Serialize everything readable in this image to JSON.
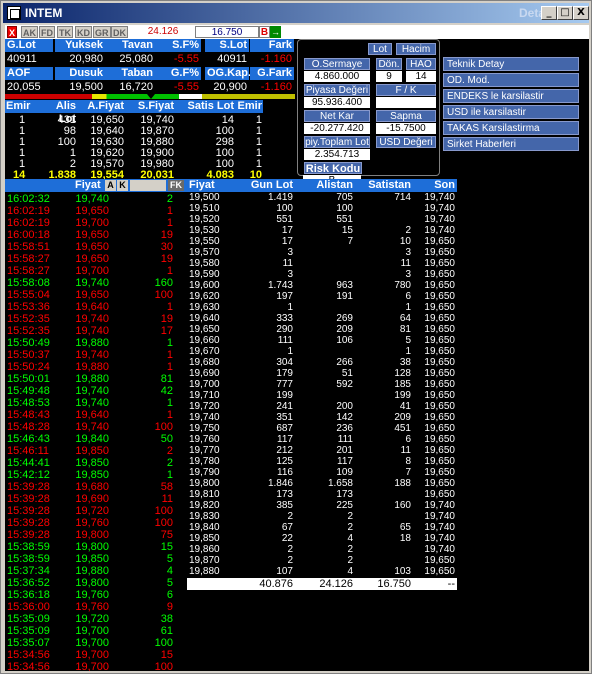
{
  "window": {
    "title": "INTEM",
    "title_right": "Detay",
    "min": "_",
    "max": "□",
    "close": "X"
  },
  "toolbar": {
    "buttons": [
      "X",
      "AK",
      "FD",
      "TK",
      "KD",
      "GR",
      "DK"
    ],
    "price1": "24.126",
    "price2": "16.750",
    "b_label": "B",
    "arrow": "→"
  },
  "summary": {
    "headers1": [
      "G.Lot",
      "Yuksek",
      "Tavan",
      "S.F%",
      "S.Lot",
      "Fark"
    ],
    "row1": [
      "40911",
      "20,980",
      "25,080",
      "-5.55",
      "40911",
      "-1.160"
    ],
    "headers2": [
      "AOF",
      "Dusuk",
      "Taban",
      "G.F%",
      "OG.Kap.",
      "G.Fark"
    ],
    "row2": [
      "20,055",
      "19,500",
      "16,720",
      "-5.55",
      "20,900",
      "-1.160"
    ]
  },
  "mid_panel": {
    "lot": "Lot",
    "hacim": "Hacim",
    "o_sermaye_label": "O.Sermaye",
    "o_sermaye": "4.860.000",
    "don_label": "Dön.",
    "don": "9",
    "hao_label": "HAO",
    "hao": "14",
    "piyasa_label": "Piyasa Değeri",
    "piyasa": "95.936.400",
    "fk_label": "F / K",
    "fk": "",
    "netkar_label": "Net Kar",
    "netkar": "-20.277.420",
    "sapma_label": "Sapma",
    "sapma": "-15.7500",
    "piyl_label": "piy.Toplam Lot",
    "piyl": "2.354.713",
    "usd_label": "USD Değeri",
    "risk_label": "Risk Kodu",
    "risk": "B"
  },
  "right_links": [
    "Teknik Detay",
    "OD. Mod.",
    "ENDEKS le karsilastir",
    "USD ile karsilastir",
    "TAKAS Karsilastirma",
    "Sirket Haberleri"
  ],
  "orderbook": {
    "headers": [
      "Emir",
      "Alis Lot",
      "A.Fiyat",
      "S.Fiyat",
      "Satis Lot",
      "Emir"
    ],
    "rows": [
      [
        "1",
        "431",
        "19,650",
        "19,740",
        "14",
        "1"
      ],
      [
        "1",
        "98",
        "19,640",
        "19,870",
        "100",
        "1"
      ],
      [
        "1",
        "100",
        "19,630",
        "19,880",
        "298",
        "1"
      ],
      [
        "1",
        "1",
        "19,620",
        "19,900",
        "100",
        "1"
      ],
      [
        "1",
        "2",
        "19,570",
        "19,980",
        "100",
        "1"
      ]
    ],
    "total": [
      "14",
      "1.838",
      "19,554",
      "20,031",
      "4.083",
      "10"
    ]
  },
  "ts_header": {
    "fiyat": "Fiyat",
    "a": "A",
    "k": "K",
    "fk": "FK"
  },
  "time_sales": [
    [
      "16:02:32",
      "19,740",
      "2",
      "g"
    ],
    [
      "16:02:19",
      "19,650",
      "1",
      "r"
    ],
    [
      "16:02:19",
      "19,700",
      "1",
      "r"
    ],
    [
      "16:00:18",
      "19,650",
      "19",
      "r"
    ],
    [
      "15:58:51",
      "19,650",
      "30",
      "r"
    ],
    [
      "15:58:27",
      "19,650",
      "19",
      "r"
    ],
    [
      "15:58:27",
      "19,700",
      "1",
      "r"
    ],
    [
      "15:58:08",
      "19,740",
      "160",
      "g"
    ],
    [
      "15:55:04",
      "19,650",
      "100",
      "r"
    ],
    [
      "15:53:36",
      "19,640",
      "1",
      "r"
    ],
    [
      "15:52:35",
      "19,740",
      "19",
      "r"
    ],
    [
      "15:52:35",
      "19,740",
      "17",
      "r"
    ],
    [
      "15:50:49",
      "19,880",
      "1",
      "g"
    ],
    [
      "15:50:37",
      "19,740",
      "1",
      "r"
    ],
    [
      "15:50:24",
      "19,880",
      "1",
      "r"
    ],
    [
      "15:50:01",
      "19,880",
      "81",
      "g"
    ],
    [
      "15:49:48",
      "19,740",
      "42",
      "g"
    ],
    [
      "15:48:53",
      "19,740",
      "1",
      "g"
    ],
    [
      "15:48:43",
      "19,640",
      "1",
      "r"
    ],
    [
      "15:48:28",
      "19,740",
      "100",
      "r"
    ],
    [
      "15:46:43",
      "19,840",
      "50",
      "g"
    ],
    [
      "15:46:11",
      "19,850",
      "2",
      "r"
    ],
    [
      "15:44:41",
      "19,850",
      "2",
      "g"
    ],
    [
      "15:42:12",
      "19,850",
      "1",
      "g"
    ],
    [
      "15:39:28",
      "19,680",
      "58",
      "r"
    ],
    [
      "15:39:28",
      "19,690",
      "11",
      "r"
    ],
    [
      "15:39:28",
      "19,720",
      "100",
      "r"
    ],
    [
      "15:39:28",
      "19,760",
      "100",
      "r"
    ],
    [
      "15:39:28",
      "19,800",
      "75",
      "r"
    ],
    [
      "15:38:59",
      "19,800",
      "15",
      "g"
    ],
    [
      "15:38:59",
      "19,850",
      "5",
      "g"
    ],
    [
      "15:37:34",
      "19,880",
      "4",
      "g"
    ],
    [
      "15:36:52",
      "19,800",
      "5",
      "g"
    ],
    [
      "15:36:18",
      "19,760",
      "6",
      "g"
    ],
    [
      "15:36:00",
      "19,760",
      "9",
      "r"
    ],
    [
      "15:35:09",
      "19,720",
      "38",
      "g"
    ],
    [
      "15:35:09",
      "19,700",
      "61",
      "g"
    ],
    [
      "15:35:07",
      "19,700",
      "100",
      "g"
    ],
    [
      "15:34:56",
      "19,700",
      "15",
      "r"
    ],
    [
      "15:34:56",
      "19,700",
      "100",
      "r"
    ]
  ],
  "depth": {
    "headers": [
      "Fiyat",
      "Gun Lot",
      "Alistan",
      "Satistan",
      "Son"
    ],
    "rows": [
      [
        "19,500",
        "1.419",
        "705",
        "714",
        "19,740"
      ],
      [
        "19,510",
        "100",
        "100",
        "",
        "19,740"
      ],
      [
        "19,520",
        "551",
        "551",
        "",
        "19,740"
      ],
      [
        "19,530",
        "17",
        "15",
        "2",
        "19,740"
      ],
      [
        "19,550",
        "17",
        "7",
        "10",
        "19,650"
      ],
      [
        "19,570",
        "3",
        "",
        "3",
        "19,650"
      ],
      [
        "19,580",
        "11",
        "",
        "11",
        "19,650"
      ],
      [
        "19,590",
        "3",
        "",
        "3",
        "19,650"
      ],
      [
        "19,600",
        "1.743",
        "963",
        "780",
        "19,650"
      ],
      [
        "19,620",
        "197",
        "191",
        "6",
        "19,650"
      ],
      [
        "19,630",
        "1",
        "",
        "1",
        "19,650"
      ],
      [
        "19,640",
        "333",
        "269",
        "64",
        "19,650"
      ],
      [
        "19,650",
        "290",
        "209",
        "81",
        "19,650"
      ],
      [
        "19,660",
        "111",
        "106",
        "5",
        "19,650"
      ],
      [
        "19,670",
        "1",
        "",
        "1",
        "19,650"
      ],
      [
        "19,680",
        "304",
        "266",
        "38",
        "19,650"
      ],
      [
        "19,690",
        "179",
        "51",
        "128",
        "19,650"
      ],
      [
        "19,700",
        "777",
        "592",
        "185",
        "19,650"
      ],
      [
        "19,710",
        "199",
        "",
        "199",
        "19,650"
      ],
      [
        "19,720",
        "241",
        "200",
        "41",
        "19,650"
      ],
      [
        "19,740",
        "351",
        "142",
        "209",
        "19,650"
      ],
      [
        "19,750",
        "687",
        "236",
        "451",
        "19,650"
      ],
      [
        "19,760",
        "117",
        "111",
        "6",
        "19,650"
      ],
      [
        "19,770",
        "212",
        "201",
        "11",
        "19,650"
      ],
      [
        "19,780",
        "125",
        "117",
        "8",
        "19,650"
      ],
      [
        "19,790",
        "116",
        "109",
        "7",
        "19,650"
      ],
      [
        "19,800",
        "1.846",
        "1.658",
        "188",
        "19,650"
      ],
      [
        "19,810",
        "173",
        "173",
        "",
        "19,650"
      ],
      [
        "19,820",
        "385",
        "225",
        "160",
        "19,740"
      ],
      [
        "19,830",
        "2",
        "2",
        "",
        "19,740"
      ],
      [
        "19,840",
        "67",
        "2",
        "65",
        "19,740"
      ],
      [
        "19,850",
        "22",
        "4",
        "18",
        "19,740"
      ],
      [
        "19,860",
        "2",
        "2",
        "",
        "19,740"
      ],
      [
        "19,870",
        "2",
        "2",
        "",
        "19,650"
      ],
      [
        "19,880",
        "107",
        "4",
        "103",
        "19,650"
      ]
    ],
    "total": [
      "40.876",
      "24.126",
      "16.750",
      "--"
    ]
  },
  "colors": {
    "header_blue": "#1e6ed8",
    "buy_green": "#00ff00",
    "sell_red": "#ff0000"
  }
}
